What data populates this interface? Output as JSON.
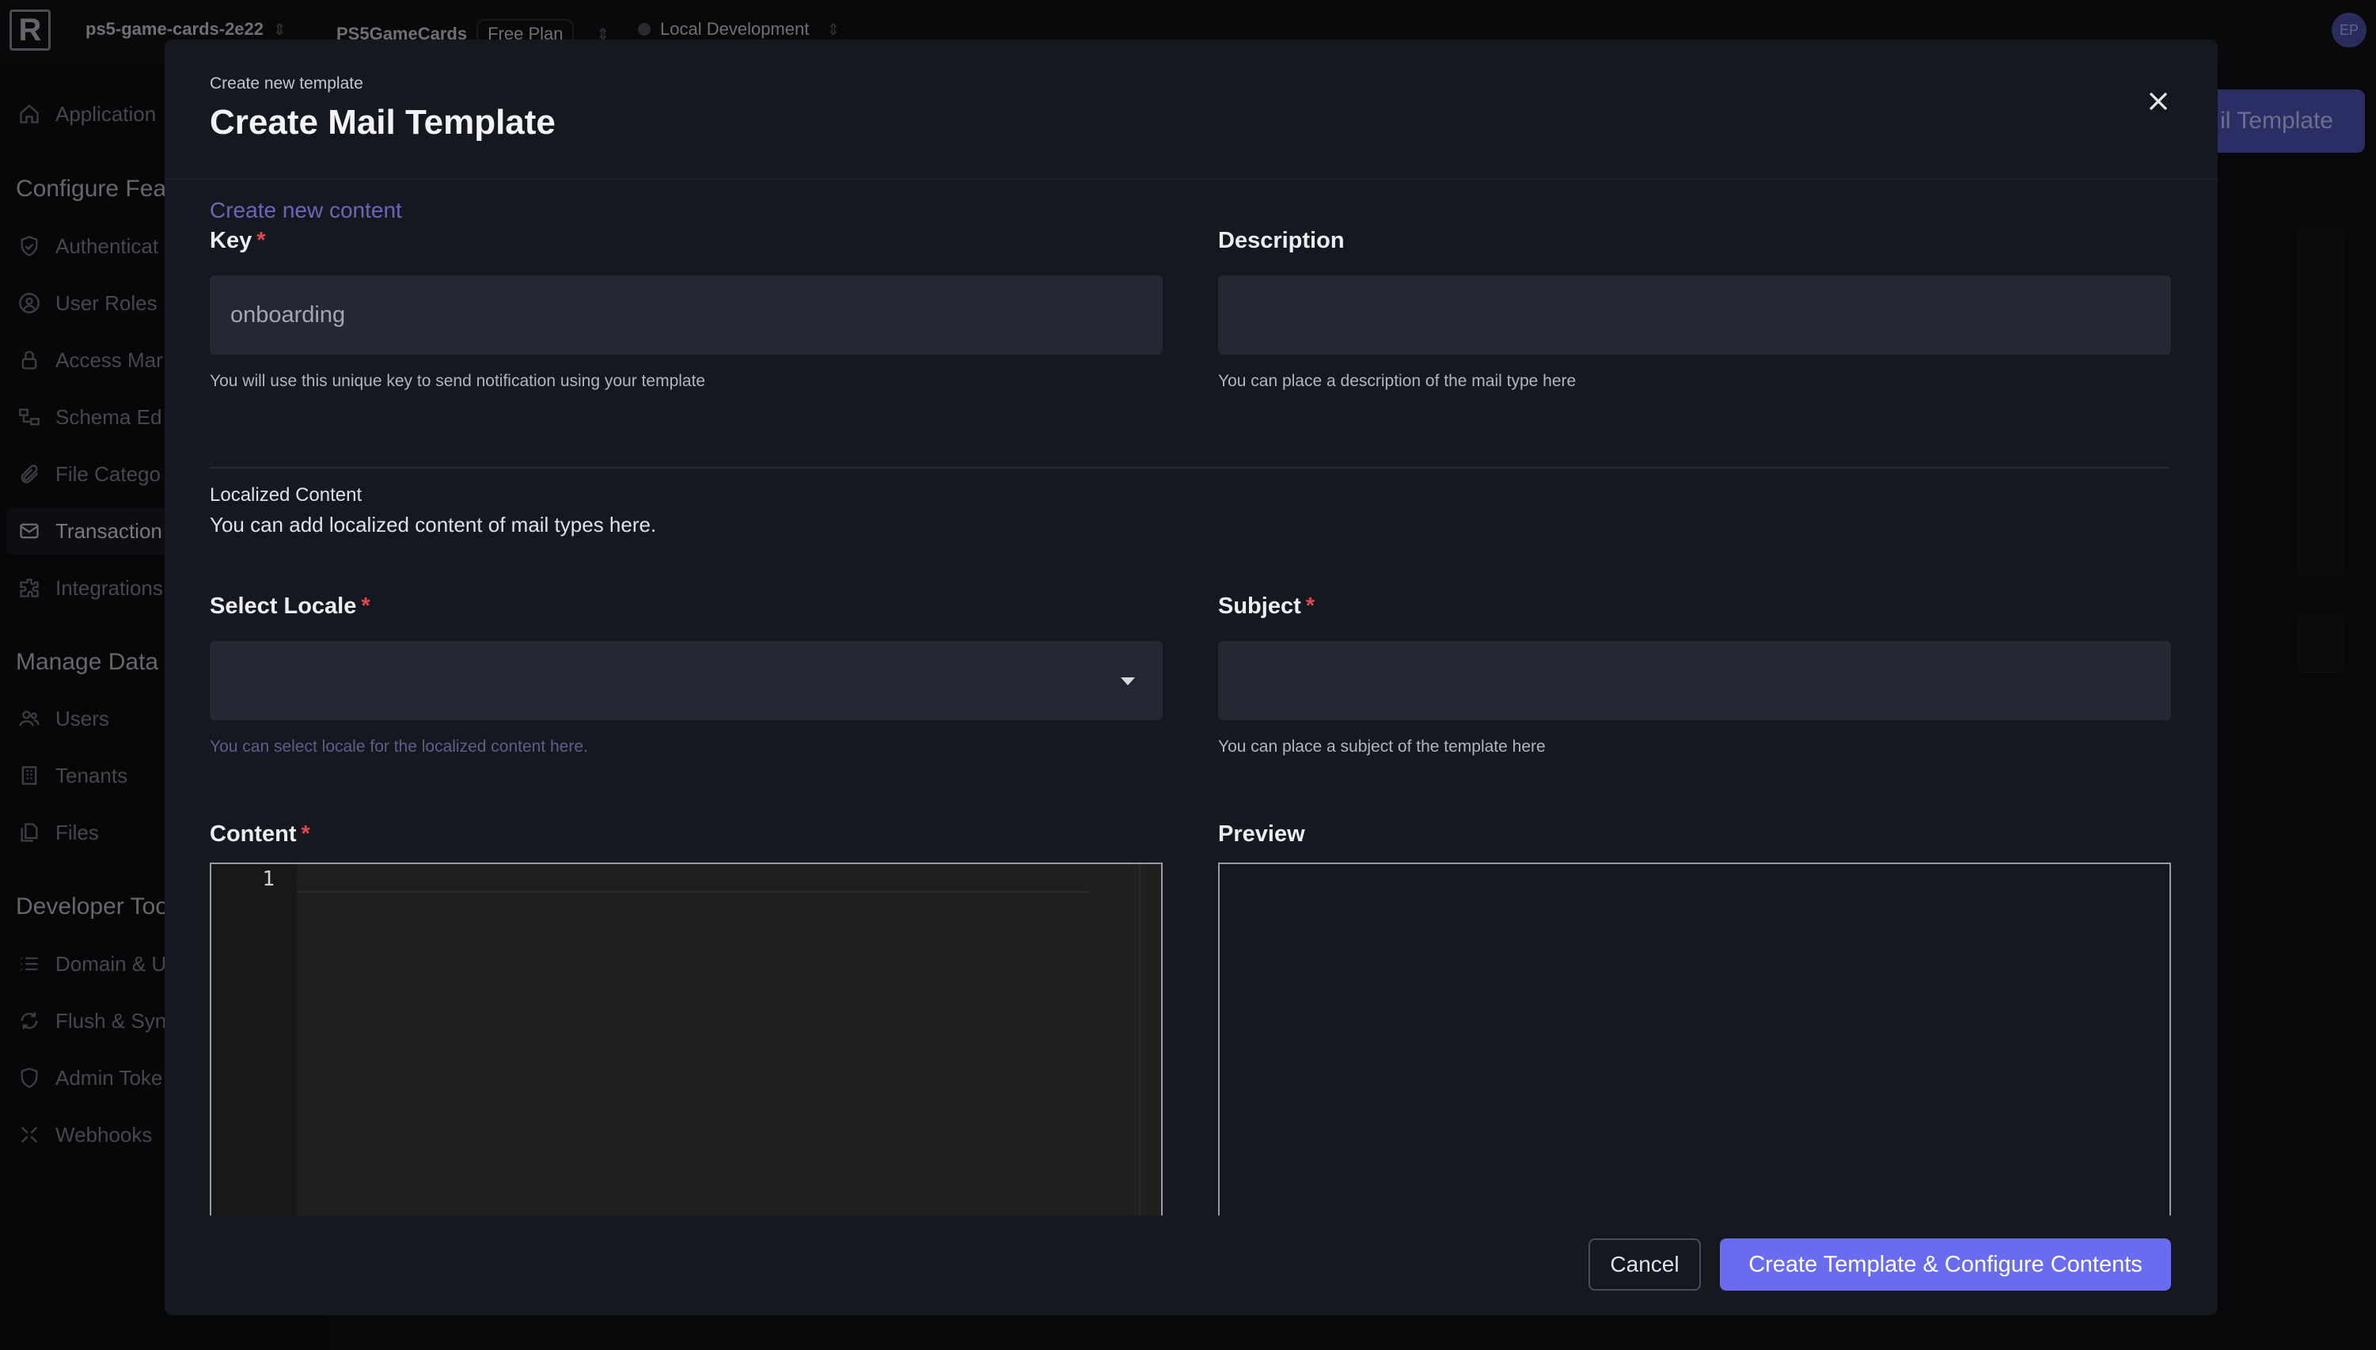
{
  "topbar": {
    "logo": "R",
    "project": "ps5-game-cards-2e22",
    "app": "PS5GameCards",
    "plan": "Free Plan",
    "environment": "Local Development",
    "avatar": "EP"
  },
  "sidebar": {
    "items_top": [
      {
        "label": "Application",
        "icon": "home-icon"
      }
    ],
    "section_configure": "Configure Fea",
    "items_configure": [
      {
        "label": "Authenticat",
        "icon": "shield-check-icon"
      },
      {
        "label": "User Roles",
        "icon": "user-circle-icon"
      },
      {
        "label": "Access Mar",
        "icon": "lock-icon"
      },
      {
        "label": "Schema Ed",
        "icon": "schema-icon"
      },
      {
        "label": "File Catego",
        "icon": "paperclip-icon"
      },
      {
        "label": "Transaction",
        "icon": "mail-icon",
        "active": true
      },
      {
        "label": "Integrations",
        "icon": "puzzle-icon"
      }
    ],
    "section_manage": "Manage Data",
    "items_manage": [
      {
        "label": "Users",
        "icon": "users-icon"
      },
      {
        "label": "Tenants",
        "icon": "building-icon"
      },
      {
        "label": "Files",
        "icon": "files-icon"
      }
    ],
    "section_developer": "Developer Too",
    "items_developer": [
      {
        "label": "Domain & U",
        "icon": "list-icon"
      },
      {
        "label": "Flush & Syn",
        "icon": "refresh-icon"
      },
      {
        "label": "Admin Toke",
        "icon": "shield-icon"
      },
      {
        "label": "Webhooks",
        "icon": "webhook-icon"
      }
    ]
  },
  "background": {
    "primary_button": "il Template"
  },
  "modal": {
    "subtitle": "Create new template",
    "title": "Create Mail Template",
    "create_new_content": "Create new content",
    "key": {
      "label": "Key",
      "value": "onboarding",
      "hint": "You will use this unique key to send notification using your template"
    },
    "description": {
      "label": "Description",
      "value": "",
      "hint": "You can place a description of the mail type here"
    },
    "localized": {
      "title": "Localized Content",
      "desc": "You can add localized content of mail types here."
    },
    "locale": {
      "label": "Select Locale",
      "value": "",
      "hint": "You can select locale for the localized content here."
    },
    "subject": {
      "label": "Subject",
      "value": "",
      "hint": "You can place a subject of the template here"
    },
    "content": {
      "label": "Content",
      "line_number": "1"
    },
    "preview": {
      "label": "Preview"
    },
    "required_mark": "*",
    "cancel": "Cancel",
    "submit": "Create Template & Configure Contents"
  },
  "colors": {
    "accent": "#6a6cf0",
    "required": "#e0484f",
    "link": "#6a67b8"
  }
}
